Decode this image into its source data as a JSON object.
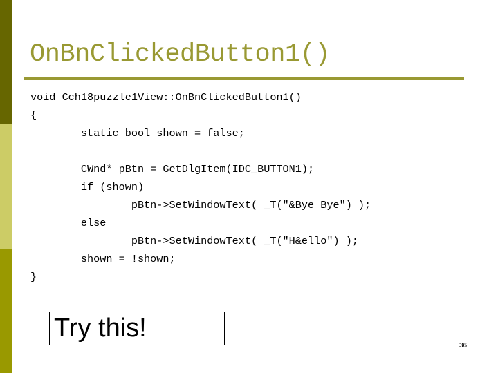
{
  "slide": {
    "title": "OnBnClickedButton1()",
    "code_lines": [
      "void Cch18puzzle1View::OnBnClickedButton1()",
      "{",
      "        static bool shown = false;",
      "",
      "        CWnd* pBtn = GetDlgItem(IDC_BUTTON1);",
      "        if (shown)",
      "                pBtn->SetWindowText( _T(\"&Bye Bye\") );",
      "        else",
      "                pBtn->SetWindowText( _T(\"H&ello\") );",
      "        shown = !shown;",
      "}"
    ],
    "callout": "Try this!",
    "page_number": "36"
  },
  "colors": {
    "sidebar_top": "#666600",
    "sidebar_middle": "#cccc66",
    "sidebar_bottom": "#999900",
    "title": "#999933",
    "rule": "#999933"
  }
}
